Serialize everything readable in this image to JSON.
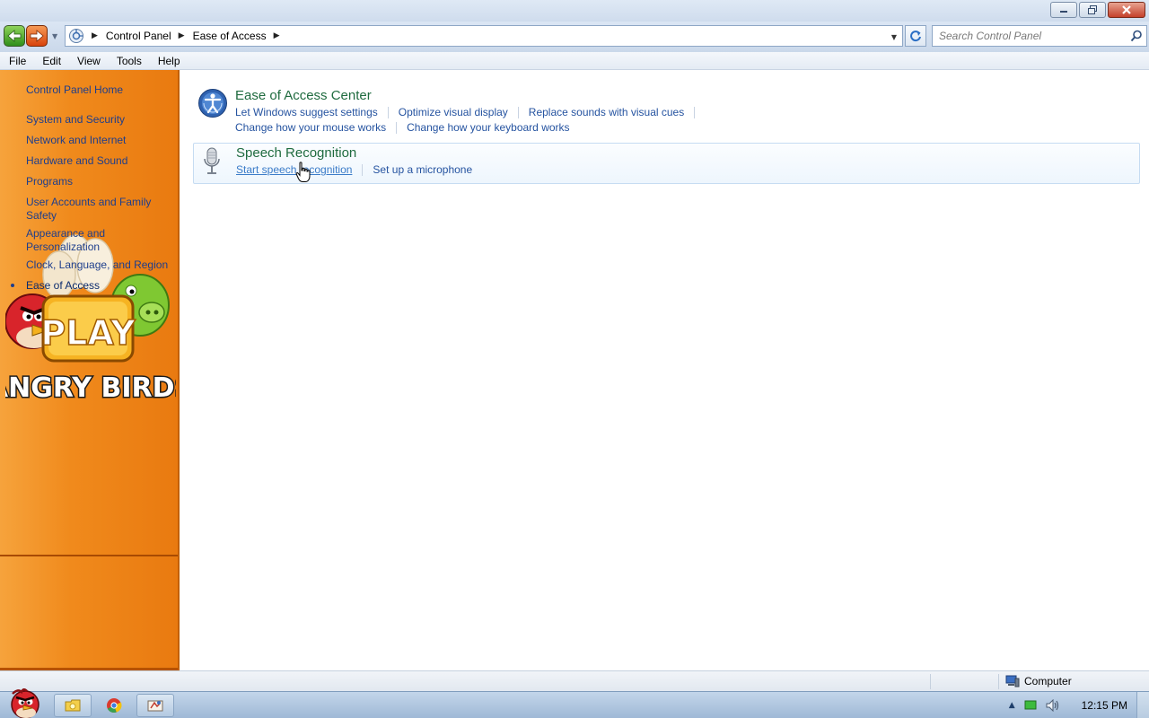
{
  "window": {
    "controls": [
      "minimize",
      "restore",
      "close"
    ]
  },
  "address_bar": {
    "breadcrumbs": [
      "Control Panel",
      "Ease of Access"
    ],
    "search_placeholder": "Search Control Panel"
  },
  "menu": {
    "items": [
      "File",
      "Edit",
      "View",
      "Tools",
      "Help"
    ]
  },
  "nav": {
    "home": "Control Panel Home",
    "items": [
      "System and Security",
      "Network and Internet",
      "Hardware and Sound",
      "Programs",
      "User Accounts and Family Safety",
      "Appearance and Personalization",
      "Clock, Language, and Region",
      "Ease of Access"
    ],
    "current": "Ease of Access",
    "pane_color": "#f08a1c"
  },
  "content": {
    "categories": [
      {
        "title": "Ease of Access Center",
        "icon": "ease-of-access-icon",
        "tasks_row1": [
          "Let Windows suggest settings",
          "Optimize visual display",
          "Replace sounds with visual cues"
        ],
        "tasks_row2": [
          "Change how your mouse works",
          "Change how your keyboard works"
        ]
      },
      {
        "title": "Speech Recognition",
        "icon": "microphone-icon",
        "tasks_row1": [
          "Start speech recognition",
          "Set up a microphone"
        ]
      }
    ]
  },
  "status_bar": {
    "location": "Computer"
  },
  "taskbar": {
    "clock": "12:15 PM",
    "pinned": [
      "explorer-icon",
      "chrome-icon",
      "control-panel-icon"
    ]
  },
  "wallpaper": {
    "play_label": "PLAY",
    "logo_text": "ANGRY BIRDS"
  }
}
